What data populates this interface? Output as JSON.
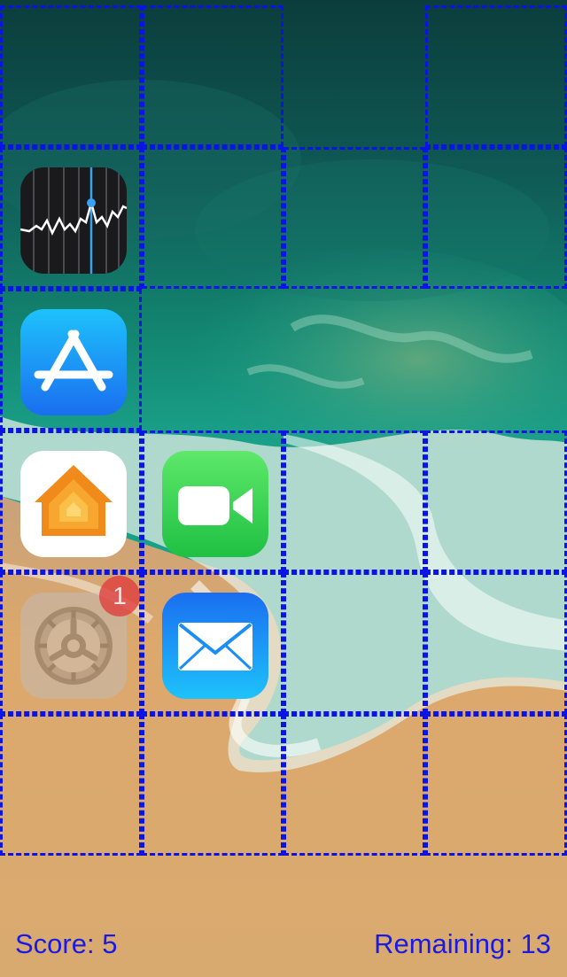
{
  "game": {
    "grid_rows": 6,
    "grid_columns": 4,
    "tiles": [
      {
        "row": 2,
        "col": 1,
        "app": "stocks-icon"
      },
      {
        "row": 3,
        "col": 1,
        "app": "app-store-icon"
      },
      {
        "row": 4,
        "col": 1,
        "app": "home-icon"
      },
      {
        "row": 4,
        "col": 2,
        "app": "facetime-icon"
      },
      {
        "row": 5,
        "col": 1,
        "app": "settings-icon",
        "faded": true,
        "badge": "1"
      },
      {
        "row": 5,
        "col": 2,
        "app": "mail-icon"
      }
    ],
    "outlined_cells": [
      [
        1,
        1
      ],
      [
        1,
        2
      ],
      [
        1,
        4
      ],
      [
        2,
        1
      ],
      [
        2,
        2
      ],
      [
        2,
        3
      ],
      [
        2,
        4
      ],
      [
        3,
        1
      ],
      [
        3,
        2
      ],
      [
        4,
        1
      ],
      [
        4,
        2
      ],
      [
        4,
        3
      ],
      [
        4,
        4
      ],
      [
        5,
        1
      ],
      [
        5,
        2
      ],
      [
        5,
        3
      ],
      [
        5,
        4
      ],
      [
        6,
        1
      ],
      [
        6,
        2
      ],
      [
        6,
        3
      ],
      [
        6,
        4
      ]
    ]
  },
  "hud": {
    "score_label": "Score: 5",
    "remaining_label": "Remaining: 13"
  },
  "colors": {
    "grid_line": "#0a14e6",
    "hud_text": "#1a1ae6",
    "badge": "#e03c3c"
  },
  "settings_badge": "1"
}
